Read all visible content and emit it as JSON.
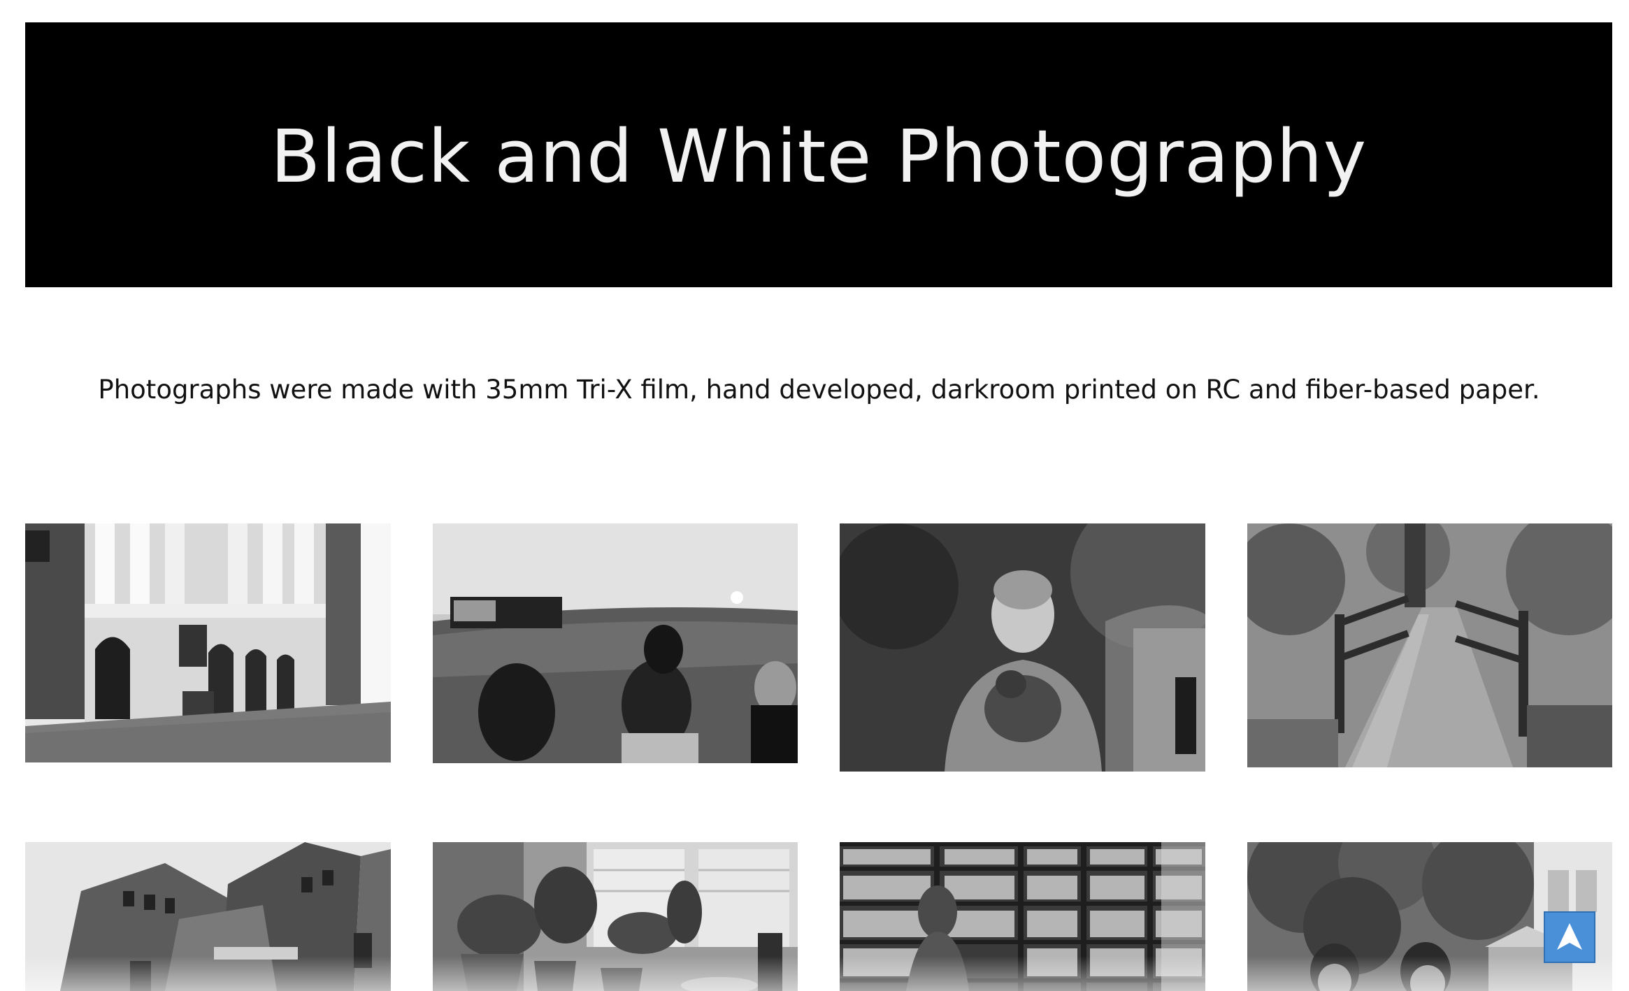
{
  "page": {
    "title": "Black and White Photography",
    "description": "Photographs were made with 35mm Tri-X film, hand developed, darkroom printed on RC and fiber-based paper."
  },
  "colors": {
    "banner_bg": "#000000",
    "banner_text": "#f2f2f2",
    "body_text": "#111111",
    "scroll_button": "#4a90d9"
  },
  "gallery": {
    "photos": [
      {
        "id": "photo-1",
        "subject": "building-with-columns"
      },
      {
        "id": "photo-2",
        "subject": "stadium-crowd"
      },
      {
        "id": "photo-3",
        "subject": "person-holding-cat"
      },
      {
        "id": "photo-4",
        "subject": "wooden-footbridge"
      },
      {
        "id": "photo-5",
        "subject": "brick-building"
      },
      {
        "id": "photo-6",
        "subject": "houseplants-by-window"
      },
      {
        "id": "photo-7",
        "subject": "bookshelves"
      },
      {
        "id": "photo-8",
        "subject": "people-under-trees"
      }
    ]
  },
  "scroll_button": {
    "icon": "arrow-up-icon"
  }
}
